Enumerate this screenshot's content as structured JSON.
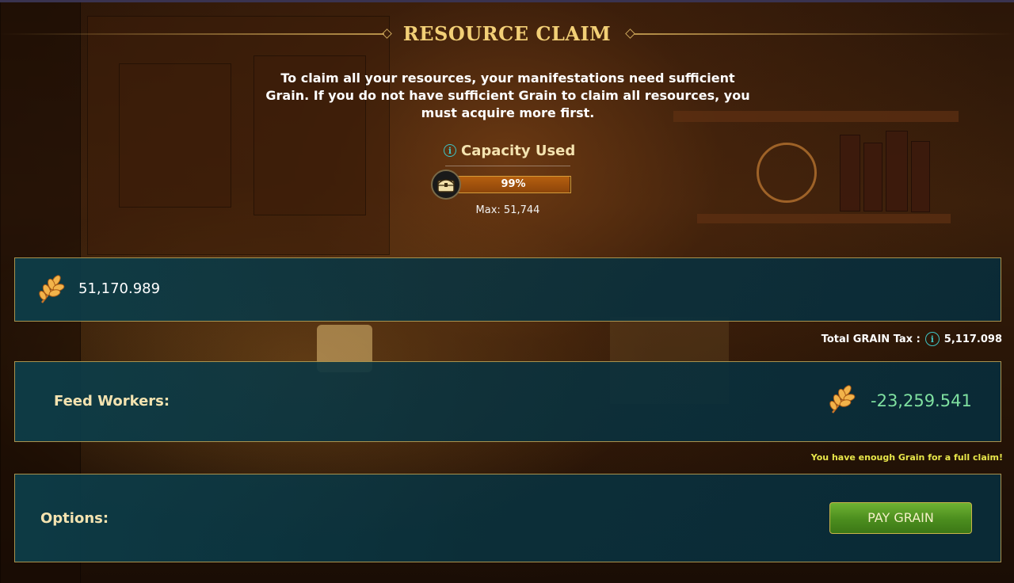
{
  "header": {
    "title": "RESOURCE CLAIM"
  },
  "intro": {
    "text": "To claim all your resources, your manifestations need sufficient Grain. If you do not have sufficient Grain to claim all resources, you must acquire more first."
  },
  "capacity": {
    "label": "Capacity Used",
    "percent_text": "99%",
    "fill_fraction": 0.99,
    "max_text": "Max: 51,744",
    "icon": "chest-icon",
    "info_icon": "info-icon"
  },
  "balance": {
    "icon": "grain-icon",
    "value": "51,170.989"
  },
  "tax": {
    "label": "Total GRAIN Tax :",
    "info_icon": "info-icon",
    "value": "5,117.098"
  },
  "feed": {
    "label": "Feed Workers:",
    "icon": "grain-icon",
    "value": "-23,259.541"
  },
  "status": {
    "message": "You have enough Grain for a full claim!"
  },
  "options": {
    "label": "Options:",
    "pay_button_label": "PAY GRAIN"
  },
  "colors": {
    "title": "#f2cf76",
    "panel_border": "#a8924e",
    "panel_bg": "#0c3e4a",
    "feed_value": "#7fe0a0",
    "status_message": "#e8e64a",
    "button": "#5a9f28",
    "capacity_fill": "#a3540d"
  }
}
